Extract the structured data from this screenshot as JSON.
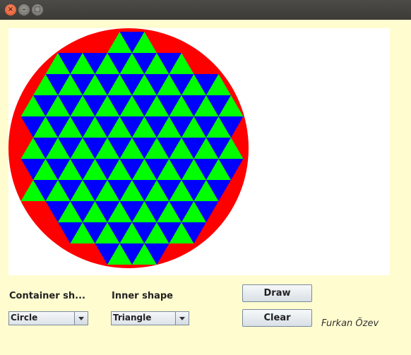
{
  "window": {
    "close_glyph": "×",
    "minimize_glyph": "–",
    "maximize_glyph": "□"
  },
  "canvas": {
    "background": "#ffffff",
    "container_color": "#ff0000",
    "fill_colors": [
      "#0000ff",
      "#00ff00"
    ]
  },
  "controls": {
    "container_label": "Container sh...",
    "inner_label": "Inner shape",
    "container_value": "Circle",
    "inner_value": "Triangle",
    "draw_label": "Draw",
    "clear_label": "Clear"
  },
  "author": "Furkan Özev"
}
